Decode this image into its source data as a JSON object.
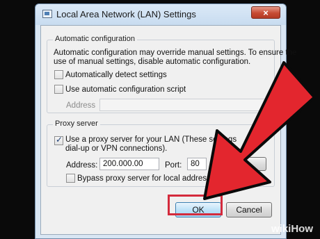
{
  "window": {
    "title": "Local Area Network (LAN) Settings",
    "close_glyph": "×"
  },
  "auto_config": {
    "legend": "Automatic configuration",
    "description_line1": "Automatic configuration may override manual settings.  To ensure the",
    "description_line2": "use of manual settings, disable automatic configuration.",
    "detect_label": "Automatically detect settings",
    "detect_checked": false,
    "script_label": "Use automatic configuration script",
    "script_checked": false,
    "address_label": "Address",
    "address_value": ""
  },
  "proxy": {
    "legend": "Proxy server",
    "use_proxy_line1": "Use a proxy server for your LAN (These settings",
    "use_proxy_line2": "dial-up or VPN connections).",
    "use_proxy_checked": true,
    "address_label": "Address:",
    "address_value": "200.000.00",
    "port_label": "Port:",
    "port_value": "80",
    "bypass_label": "Bypass proxy server for local addresses",
    "bypass_checked": false
  },
  "buttons": {
    "ok_label": "OK",
    "cancel_label": "Cancel"
  },
  "annotation": {
    "arrow_color": "#e3262e",
    "highlight_color": "#d42a3c"
  },
  "watermark": {
    "text": "wikiHow"
  }
}
